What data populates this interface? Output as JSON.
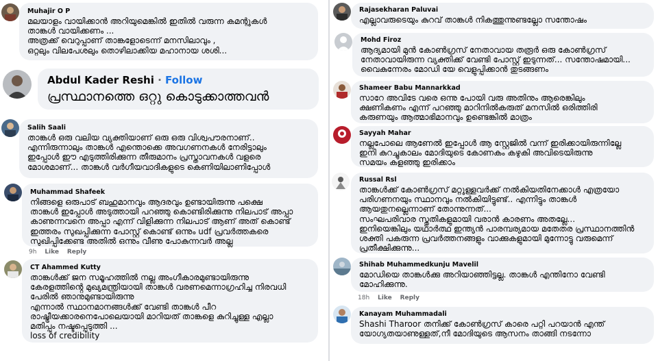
{
  "left": [
    {
      "name": "Muhajir O P",
      "text": "മലയാളം വായിക്കാൻ അറിയുമെങ്കിൽ ഇതിൽ വരുന്ന കമന്റുകൾ\nതാങ്കൾ വായിക്കണം ...\nഅത്രക്ക് വെറുപ്പാണ് താങ്കളോടെന്ന് മനസിലാവും ,\nഒറ്റലും വിലപേശലും തൊഴിലാക്കിയ മഹാനായ ശശി..."
    },
    {
      "name": "Abdul Kader Reshi",
      "separator": "·",
      "follow": "Follow",
      "text": "പ്രസ്ഥാനത്തെ ഒറ്റു കൊടുക്കാത്തവൻ"
    },
    {
      "name": "Salih Saali",
      "text": "താങ്കൾ ഒരു വലിയ വ്യക്തിയാണ് ഒരു ഒരു വിശ്വപൗരനാണ്..\nഎന്നിരുന്നാലും താങ്കൾ എന്തൊക്കെ അവഗണനകൾ നേരിട്ടാലും\nഇപ്പോൾ ഈ എടുത്തിരിക്കുന്ന തീരുമാനം പ്രസ്താവനകൾ വളരെ\nമോശമാണ്... താങ്കൾ വർഗീയവാദികളുടെ കെണിയിലാണിപ്പോൾ"
    },
    {
      "name": "Muhammad Shafeek",
      "text": "നിങ്ങളെ ഒരുപാട് ബഹുമാനവും ആദരവും ഉണ്ടായിരുന്നു പക്ഷെ\nതാങ്കൾ ഇപ്പോൾ അടുത്തായി പറഞ്ഞു കൊണ്ടിരിക്കുന്നു നിലപാട് അപ്പാ\nകാണുന്നവനെ അപ്പാ എന്ന് വിളിക്കുന്ന നിലപാട് ആണ് അത് കൊണ്ട്\nഇത്തരം സുഖപ്പിക്കുന്ന പോസ്റ്റ് കൊണ്ട് ഒന്നും udf പ്രവർത്തകരെ\nസുഖിപ്പിക്കേണ്ട അതിൽ ഒന്നും വീണു പോകുന്നവർ അല്ല",
      "meta": {
        "time": "9h",
        "like": "Like",
        "reply": "Reply"
      }
    },
    {
      "name": "CT Ahammed Kutty",
      "text": "താങ്കൾക്ക് ജന സമൂഹത്തിൽ നല്ല അംഗീകാരമുണ്ടായിരുന്നു\nകേരളത്തിൻ്റെ മുഖ്യമന്ത്രിയായി താങ്കൾ വരണമെന്നാഗ്രഹിച്ച നിരവധി\nപേരിൽ ഞാനുമുണ്ടായിരുന്നു\nഎന്നാൽ സ്ഥാനമാനങ്ങൾക്ക് വേണ്ടി താങ്കൾ പീറ\nരാഷ്ട്രീയക്കാരനെപോലെയായി മാറിയത് താങ്കളെ കുറിച്ചുള്ള എല്ലാ\nമതിപ്പും നഷ്ടപ്പെടുത്തി ...\nloss of credibility"
    }
  ],
  "right": [
    {
      "name": "Rajasekharan Paluvai",
      "text": "എല്ലാവരുടെയും കുറവ് താങ്കൾ നികത്തുന്നുണ്ടല്ലോ സന്തോഷം"
    },
    {
      "name": "Mohd Firoz",
      "text": "ആദ്യമായി മുൻ കോൺഗ്രസ് നേതാവായ തരൂർ ഒരു കോൺഗ്രസ്\nനേതാവായിരുന്ന വ്യക്തിക്ക് വേണ്ടി പോസ്റ്റ് ഇടുന്നത്... സന്തോഷമായി...\nവൈകുന്നേരം മോഡി യേ വെളുപ്പിക്കാൻ തുടങ്ങണം"
    },
    {
      "name": "Shameer Babu Mannarkkad",
      "text": "സാറേ അവിടേ വരെ ഒന്നു പോയി വരു അതിനും ആരെങ്കിലും\nക്ഷണികണം എന്ന് പറഞ്ഞു മാറിനിൽകരുത് മനസിൽ ഒരിത്തിരി\nകരുണയും ആത്മാഭിമാനവും ഉണ്ടെങ്കിൽ മാത്രം"
    },
    {
      "name": "Sayyah Mahar",
      "text": "നല്ലപോലെ ആണേൽ ഇപ്പോൾ ആ സ്റ്റേജിൽ വന്ന് ഇരിക്കായിരുന്നില്ലേ\nഇനി കുറച്ചുകാലം മോദിയുടെ കോണകം കഴുകി അവിടെയിരുന്നു\nസമയം കളഞ്ഞു ഇരിക്കാം"
    },
    {
      "name": "Russal Rsl",
      "text": "താങ്കൾക്ക് കോൺഗ്രസ് മറ്റുള്ളവർക്ക് നൽകിയതിനേക്കാൾ എത്രയോ\nപരിഗണനയും സ്ഥാനവും നൽകിയിട്ടുണ്ട്.. എന്നിട്ടും താങ്കൾ\nആയതുനല്ലെന്നാണ് തോന്നുന്നത്...\nസംഘപരിവാര സ്തുതികളുമായി വരാൻ കാരണം അതല്ലേ...\nഇനിയെങ്കിലും യഥാർത്ഥ ഇന്ത്യൻ പാരമ്പര്യമായ മതേതര പ്രസ്ഥാനത്തിൻ\nശക്തി പകരുന്ന പ്രവർത്തനങ്ങളും വാക്കുകളുമായി മുന്നോട്ടു വരുമെന്ന്\nപ്രതീക്ഷിക്കുന്നു..."
    },
    {
      "name": "Shihab Muhammedkunju Mavelil",
      "text": "മോഡിയെ താങ്കൾക്കു അറിയാഞ്ഞിട്ടല്ല. താങ്കൾ എന്തിനോ വേണ്ടി\nമോഹിക്കുന്നു.",
      "meta": {
        "time": "18h",
        "like": "Like",
        "reply": "Reply"
      }
    },
    {
      "name": "Kanayam Muhammadali",
      "text": "Shashi Tharoor തനിക്ക് കോൺഗ്രസ് കാരെ പറ്റി പറയാൻ എന്ത്\nയോഗ്യതയാണുള്ളത്,നീ മോദിയുടെ ആസനം താങ്ങി നടന്നോ"
    }
  ],
  "colors": {
    "bubble": "#f0f2f5",
    "text": "#050505",
    "meta": "#65676b",
    "follow": "#1b74e4"
  },
  "icons": [
    "avatar-photo",
    "default-avatar-icon"
  ]
}
